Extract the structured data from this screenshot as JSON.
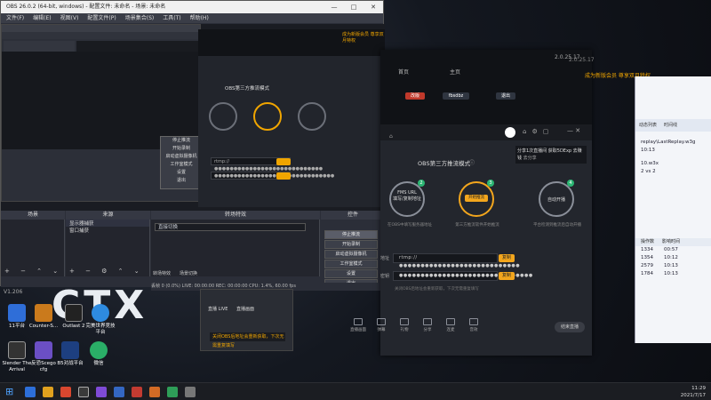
{
  "obs": {
    "title": "OBS 26.0.2 (64-bit, windows) - 配置文件: 未命名 - 场景: 未命名",
    "menu": [
      "文件(F)",
      "编辑(E)",
      "视图(V)",
      "配置文件(P)",
      "场景集合(S)",
      "工具(T)",
      "帮助(H)"
    ],
    "docks": {
      "scenes": "场景",
      "sources": "来源",
      "mixer": "混音器",
      "transitions": "转场特效",
      "controls": "控件"
    },
    "sources": [
      "显示器捕获",
      "窗口捕获"
    ],
    "scene_transition": "直接切换",
    "controls": [
      "停止推流",
      "开始录制",
      "启动虚拟摄像机",
      "工作室模式",
      "设置",
      "退出"
    ],
    "dock_tabs": [
      "转场特效",
      "场景切换"
    ],
    "status": "丢帧 0 (0.0%)  LIVE: 00:00:00  REC: 00:00:00  CPU: 1.4%, 60.00 fps"
  },
  "desktop": {
    "logo": "CTX",
    "version": "V1.206",
    "icons": [
      {
        "label": "11平台",
        "color": "#2f6ed8"
      },
      {
        "label": "Counter-S...",
        "color": "#ca7a1c"
      },
      {
        "label": "Outlast 2",
        "color": "#222222"
      },
      {
        "label": "完美世界竞技平台",
        "color": "#2e8be0"
      },
      {
        "label": "Slender The Arrival",
        "color": "#333333"
      },
      {
        "label": "反恐Scego cfg",
        "color": "#6b4fc4"
      },
      {
        "label": "B5对战平台",
        "color": "#1d3f80"
      },
      {
        "label": "微信",
        "color": "#2aae67"
      }
    ]
  },
  "stream_tool": {
    "version": "2.0.25.17",
    "promo": "成为新版会员 尊享双月特权",
    "promo_small": "成为新版会员 尊享双月特权",
    "nav": [
      "首页",
      "主页",
      "我的"
    ],
    "tabs": [
      "改版",
      "fbsdbz",
      "退出"
    ],
    "mode_title": "OBS第三方推流模式",
    "tip": "分享1次直播间 获取5DExp 去赚钱",
    "tip_button": "去分享",
    "steps": [
      {
        "label": "FMS URL",
        "sub": "填写/复制地址",
        "num": "2",
        "desc": "在OBS中填写服务器地址"
      },
      {
        "label": "开始推流",
        "sub": "",
        "num": "3",
        "desc": "第三方推流软件开始推流"
      },
      {
        "label": "自动开播",
        "sub": "",
        "num": "4",
        "desc": "平台检测到推流后自动开播"
      }
    ],
    "url_label": "地址",
    "url_value": "rtmp://●●●●●●●●●●●●●●●●●●●●●●●●●●●●",
    "key_label": "密钥",
    "key_value": "●●●●●●●●●●●●●●●●●●●●●●●●●●●●●●●",
    "copy": "复制",
    "edit": "编辑",
    "note": "关闭OBS后地址会重新获取，下次无需重复填写",
    "toolbar": [
      "直播画面",
      "弹幕",
      "礼物",
      "分享",
      "连麦",
      "音效",
      "房间设置"
    ],
    "end_button": "结束直播",
    "footer_left": "直播 LIVE"
  },
  "file_window": {
    "tabs": [
      "动态列表",
      "时间线"
    ],
    "path": "replay\\LastReplay.w3g",
    "items": [
      "10:13",
      "10.w3x",
      "2 vs 2"
    ],
    "headers": [
      "操作数",
      "影响时间"
    ],
    "rows": [
      [
        "1334",
        "00:57"
      ],
      [
        "1354",
        "10:12"
      ],
      [
        "2579",
        "10:13"
      ],
      [
        "1784",
        "10:13"
      ]
    ]
  },
  "taskbar": {
    "time": "11:29",
    "date": "2021/7/17",
    "apps": [
      "#2d6fd9",
      "#e0a11e",
      "#d9472f",
      "#3a3a3a",
      "#7f4bd6",
      "#3467c2",
      "#c23b31",
      "#d36b25",
      "#2e9e58",
      "#777777"
    ]
  }
}
